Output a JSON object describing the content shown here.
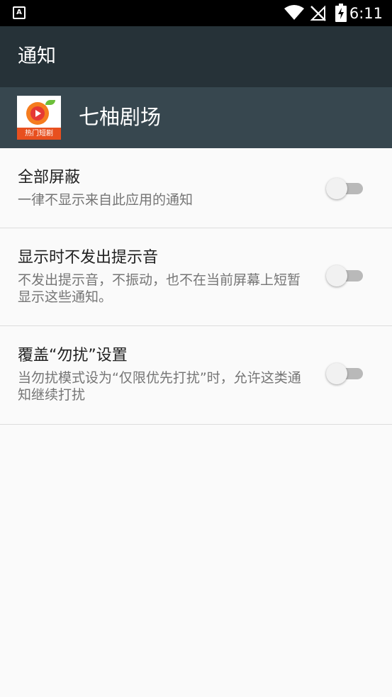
{
  "status_bar": {
    "left_icon_text": "A",
    "time": "6:11",
    "icons": [
      "notification-a-icon",
      "wifi-icon",
      "no-signal-icon",
      "battery-charging-icon"
    ]
  },
  "action_bar": {
    "title": "通知"
  },
  "app_header": {
    "app_name": "七柚剧场",
    "icon_banner_text": "热门短剧",
    "icon_colors": {
      "orange": "#f57c1f",
      "red": "#e53935",
      "leaf": "#6cbf3a",
      "banner": "#e8501f"
    }
  },
  "settings": [
    {
      "title": "全部屏蔽",
      "subtitle": "一律不显示来自此应用的通知",
      "enabled": false
    },
    {
      "title": "显示时不发出提示音",
      "subtitle": "不发出提示音，不振动，也不在当前屏幕上短暂显示这些通知。",
      "enabled": false
    },
    {
      "title": "覆盖“勿扰”设置",
      "subtitle": "当勿扰模式设为“仅限优先打扰”时，允许这类通知继续打扰",
      "enabled": false
    }
  ],
  "colors": {
    "status_bar": "#000000",
    "action_bar": "#263238",
    "app_header": "#37474f",
    "background": "#fafafa",
    "divider": "#dddddd"
  }
}
